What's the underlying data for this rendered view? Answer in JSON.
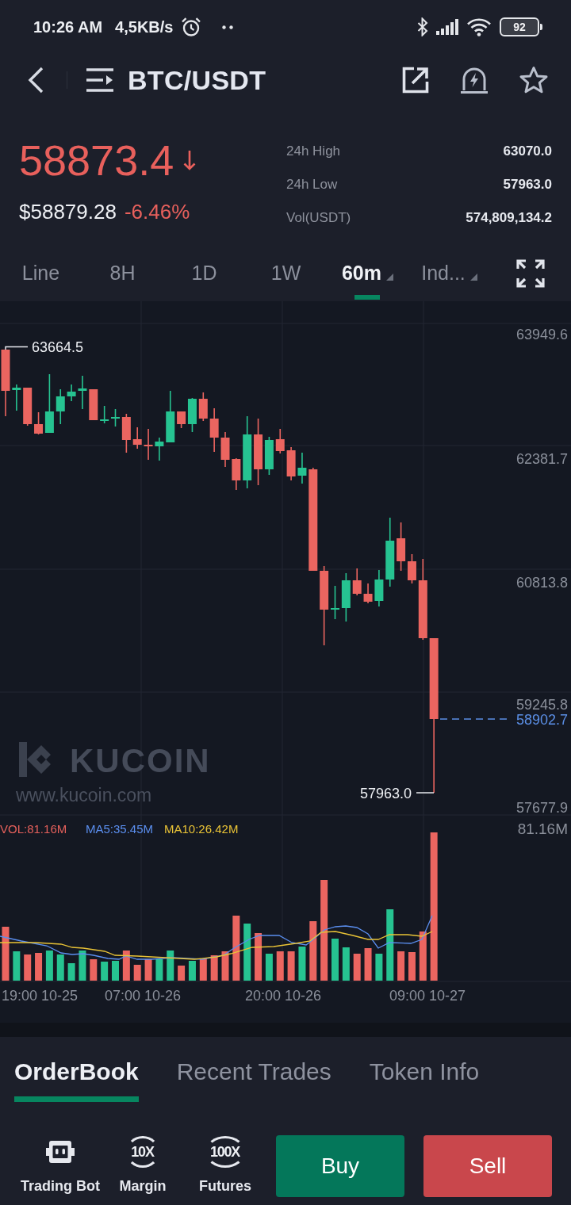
{
  "status_bar": {
    "time": "10:26 AM",
    "speed": "4,5KB/s",
    "battery": "92"
  },
  "header": {
    "title": "BTC/USDT"
  },
  "ticker": {
    "price": "58873.4",
    "falling": true,
    "usd_price": "$58879.28",
    "change": "-6.46%",
    "stats": [
      {
        "label": "24h High",
        "value": "63070.0"
      },
      {
        "label": "24h Low",
        "value": "57963.0"
      },
      {
        "label": "Vol(USDT)",
        "value": "574,809,134.2"
      }
    ]
  },
  "intervals": [
    {
      "label": "Line",
      "selected": false,
      "dropdown": false
    },
    {
      "label": "8H",
      "selected": false,
      "dropdown": false
    },
    {
      "label": "1D",
      "selected": false,
      "dropdown": false
    },
    {
      "label": "1W",
      "selected": false,
      "dropdown": false
    },
    {
      "label": "60m",
      "selected": true,
      "dropdown": true
    },
    {
      "label": "Ind...",
      "selected": false,
      "dropdown": true
    }
  ],
  "chart": {
    "y_labels": [
      "63949.6",
      "62381.7",
      "60813.8",
      "59245.8",
      "57677.9"
    ],
    "high_label": "63664.5",
    "low_label": "57963.0",
    "last_price": "58902.7",
    "watermark": {
      "brand": "KUCOIN",
      "url": "www.kucoin.com"
    }
  },
  "volume": {
    "legend": [
      {
        "kind": "vol",
        "text": "VOL:81.16M"
      },
      {
        "kind": "ma5",
        "text": "MA5:35.45M"
      },
      {
        "kind": "ma10",
        "text": "MA10:26.42M"
      }
    ],
    "max_label": "81.16M"
  },
  "time_labels": [
    "19:00 10-25",
    "07:00 10-26",
    "20:00 10-26",
    "09:00 10-27"
  ],
  "bottom_tabs": [
    {
      "label": "OrderBook",
      "selected": true
    },
    {
      "label": "Recent Trades",
      "selected": false
    },
    {
      "label": "Token Info",
      "selected": false
    }
  ],
  "shortcuts": [
    {
      "kind": "bot",
      "label": "Trading Bot"
    },
    {
      "kind": "leverage",
      "badge": "10X",
      "label": "Margin"
    },
    {
      "kind": "leverage",
      "badge": "100X",
      "label": "Futures"
    }
  ],
  "actions": [
    {
      "kind": "buy",
      "label": "Buy"
    },
    {
      "kind": "sell",
      "label": "Sell"
    }
  ]
}
